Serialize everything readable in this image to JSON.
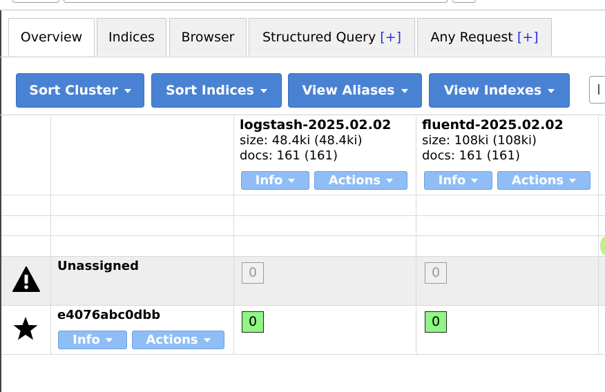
{
  "tabs": [
    {
      "label": "Overview",
      "plus": ""
    },
    {
      "label": "Indices",
      "plus": ""
    },
    {
      "label": "Browser",
      "plus": ""
    },
    {
      "label": "Structured Query ",
      "plus": "[+]"
    },
    {
      "label": "Any Request ",
      "plus": "[+]"
    }
  ],
  "toolbar": {
    "sort_cluster": "Sort Cluster",
    "sort_indices": "Sort Indices",
    "view_aliases": "View Aliases",
    "view_indexes": "View Indexes",
    "search_placeholder": "I"
  },
  "indices": [
    {
      "name": "logstash-2025.02.02",
      "size": "size: 48.4ki (48.4ki)",
      "docs": "docs: 161 (161)",
      "info": "Info",
      "actions": "Actions"
    },
    {
      "name": "fluentd-2025.02.02",
      "size": "size: 108ki (108ki)",
      "docs": "docs: 161 (161)",
      "info": "Info",
      "actions": "Actions"
    }
  ],
  "rows": {
    "unassigned": {
      "label": "Unassigned",
      "icon": "warning-icon",
      "shards": [
        "0",
        "0"
      ]
    },
    "node": {
      "label": "e4076abc0dbb",
      "icon": "star-icon",
      "info": "Info",
      "actions": "Actions",
      "shards": [
        "0",
        "0"
      ]
    }
  },
  "colors": {
    "primary_button": "#4a82d3",
    "small_button": "#8fbdf6",
    "assigned_shard": "#8ff584",
    "tab_plus": "#2a2ae0"
  }
}
